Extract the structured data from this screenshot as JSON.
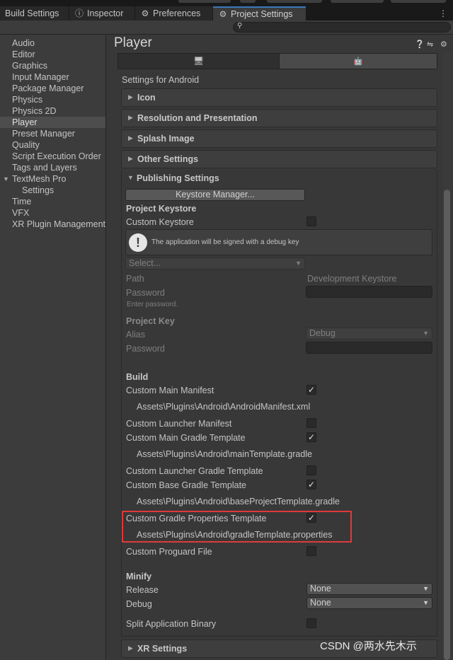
{
  "tabs": [
    {
      "label": "Build Settings",
      "icon": ""
    },
    {
      "label": "Inspector",
      "icon": "info-icon"
    },
    {
      "label": "Preferences",
      "icon": "gear-icon"
    },
    {
      "label": "Project Settings",
      "icon": "gear-icon",
      "active": true
    }
  ],
  "search": {
    "placeholder": ""
  },
  "nav": {
    "items": [
      {
        "label": "Audio"
      },
      {
        "label": "Editor"
      },
      {
        "label": "Graphics"
      },
      {
        "label": "Input Manager"
      },
      {
        "label": "Package Manager"
      },
      {
        "label": "Physics"
      },
      {
        "label": "Physics 2D"
      },
      {
        "label": "Player",
        "selected": true
      },
      {
        "label": "Preset Manager"
      },
      {
        "label": "Quality"
      },
      {
        "label": "Script Execution Order"
      },
      {
        "label": "Tags and Layers"
      },
      {
        "label": "TextMesh Pro",
        "expanded": true
      },
      {
        "label": "Settings",
        "child": true
      },
      {
        "label": "Time"
      },
      {
        "label": "VFX"
      },
      {
        "label": "XR Plugin Management"
      }
    ]
  },
  "header": {
    "title": "Player"
  },
  "platforms": {
    "tabs": [
      {
        "icon": "monitor-icon"
      },
      {
        "icon": "android-icon",
        "active": true
      }
    ]
  },
  "settings_for": "Settings for Android",
  "sections": {
    "icon": "Icon",
    "resolution": "Resolution and Presentation",
    "splash": "Splash Image",
    "other": "Other Settings",
    "publishing": "Publishing Settings",
    "xr": "XR Settings"
  },
  "publishing": {
    "keystore_manager_button": "Keystore Manager...",
    "project_keystore_heading": "Project Keystore",
    "custom_keystore_label": "Custom Keystore",
    "custom_keystore_checked": false,
    "help_text": "The application will be signed with a debug key",
    "select_placeholder": "Select...",
    "path_label": "Path",
    "path_value": "Development Keystore",
    "password_label": "Password",
    "enter_password_hint": "Enter password.",
    "project_key_heading": "Project Key",
    "alias_label": "Alias",
    "alias_value": "Debug",
    "key_password_label": "Password",
    "build_heading": "Build",
    "build_rows": [
      {
        "label": "Custom Main Manifest",
        "checked": true,
        "path": "Assets\\Plugins\\Android\\AndroidManifest.xml"
      },
      {
        "label": "Custom Launcher Manifest",
        "checked": false,
        "path": ""
      },
      {
        "label": "Custom Main Gradle Template",
        "checked": true,
        "path": "Assets\\Plugins\\Android\\mainTemplate.gradle"
      },
      {
        "label": "Custom Launcher Gradle Template",
        "checked": false,
        "path": ""
      },
      {
        "label": "Custom Base Gradle Template",
        "checked": true,
        "path": "Assets\\Plugins\\Android\\baseProjectTemplate.gradle"
      },
      {
        "label": "Custom Gradle Properties Template",
        "checked": true,
        "path": "Assets\\Plugins\\Android\\gradleTemplate.properties"
      },
      {
        "label": "Custom Proguard File",
        "checked": false,
        "path": ""
      }
    ],
    "minify_heading": "Minify",
    "release_label": "Release",
    "release_value": "None",
    "debug_label": "Debug",
    "debug_value": "None",
    "split_label": "Split Application Binary",
    "split_checked": false
  },
  "watermark": "CSDN @两水先木示",
  "colors": {
    "highlight_box": "#e0393a",
    "active_tab_accent": "#3a79bb"
  }
}
